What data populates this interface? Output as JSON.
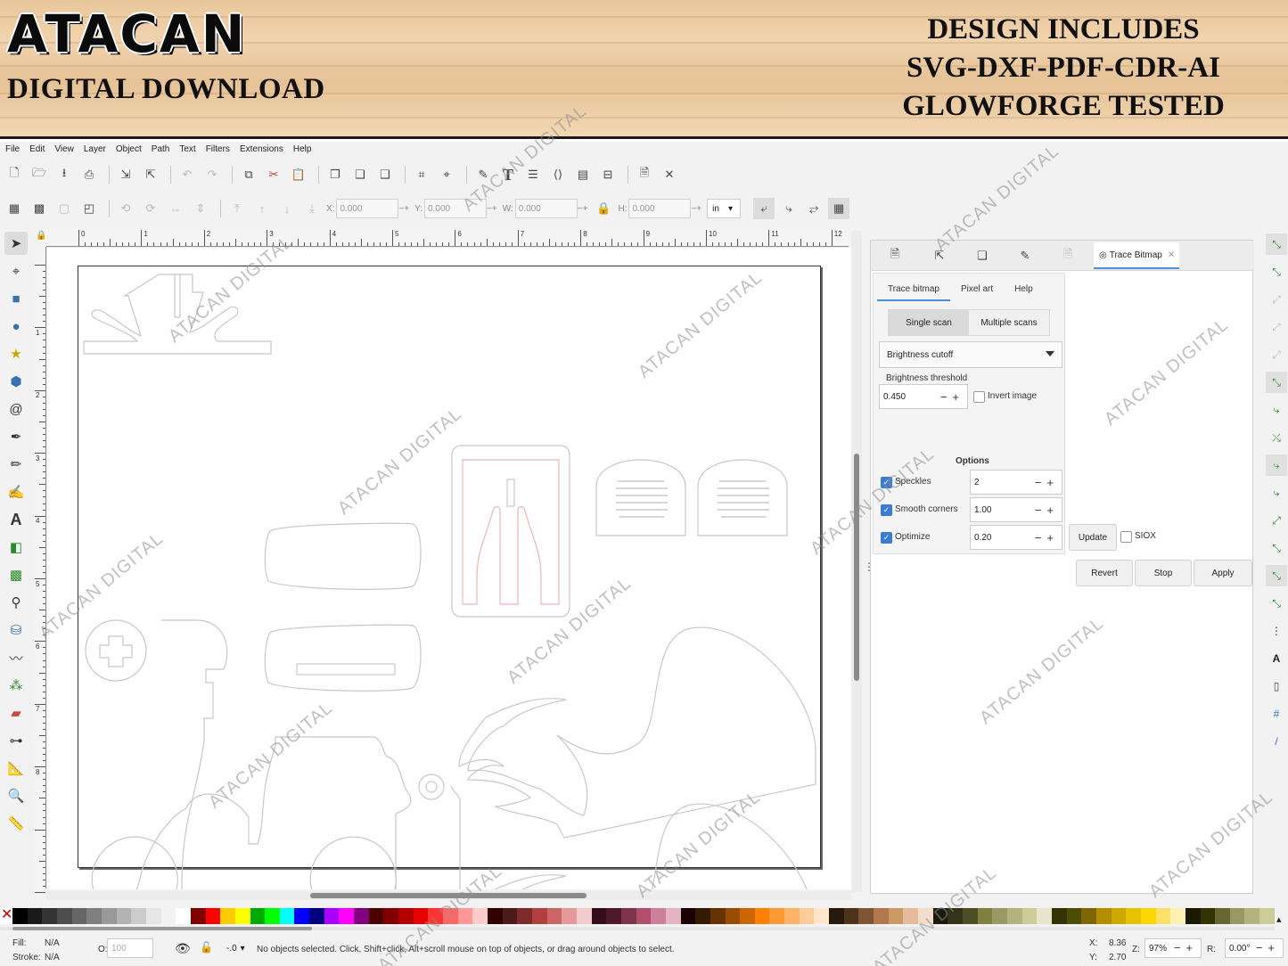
{
  "banner": {
    "logo": "ATACAN",
    "subtitle": "DIGITAL DOWNLOAD",
    "promo": [
      "DESIGN INCLUDES",
      "SVG-DXF-PDF-CDR-AI",
      "GLOWFORGE TESTED"
    ]
  },
  "menubar": [
    "File",
    "Edit",
    "View",
    "Layer",
    "Object",
    "Path",
    "Text",
    "Filters",
    "Extensions",
    "Help"
  ],
  "coords": {
    "x_label": "X:",
    "x_value": "0.000",
    "y_label": "Y:",
    "y_value": "0.000",
    "w_label": "W:",
    "w_value": "0.000",
    "h_label": "H:",
    "h_value": "0.000",
    "unit": "in"
  },
  "ruler_labels": [
    "0",
    "1",
    "2",
    "3",
    "4",
    "5",
    "6",
    "7",
    "8",
    "9",
    "10",
    "11",
    "12"
  ],
  "ruler_left_labels": [
    "1",
    "2",
    "3",
    "4",
    "5",
    "6",
    "7",
    "8"
  ],
  "dock": {
    "active_tab": "Trace Bitmap",
    "subtabs": [
      "Trace bitmap",
      "Pixel art",
      "Help"
    ],
    "scan_modes": [
      "Single scan",
      "Multiple scans"
    ],
    "mode": "Brightness cutoff",
    "threshold_label": "Brightness threshold",
    "threshold_value": "0.450",
    "invert_label": "Invert image",
    "options_heading": "Options",
    "speckles_label": "Speckles",
    "speckles_value": "2",
    "smooth_label": "Smooth corners",
    "smooth_value": "1.00",
    "optimize_label": "Optimize",
    "optimize_value": "0.20",
    "update": "Update",
    "siox": "SIOX",
    "revert": "Revert",
    "stop": "Stop",
    "apply": "Apply"
  },
  "status": {
    "fill_label": "Fill:",
    "fill_value": "N/A",
    "stroke_label": "Stroke:",
    "stroke_value": "N/A",
    "opacity_label": "O:",
    "opacity_value": "100",
    "layer_value": "-.0",
    "message": "No objects selected. Click, Shift+click, Alt+scroll mouse on top of objects, or drag around objects to select.",
    "x_label": "X:",
    "x_value": "8.36",
    "y_label": "Y:",
    "y_value": "2.70",
    "zoom_label": "Z:",
    "zoom_value": "97%",
    "rot_label": "R:",
    "rot_value": "0.00°"
  },
  "watermark": "ATACAN DIGITAL",
  "palette": [
    "#000000",
    "#1a1a1a",
    "#333333",
    "#4d4d4d",
    "#666666",
    "#808080",
    "#999999",
    "#b3b3b3",
    "#cccccc",
    "#e6e6e6",
    "#f2f2f2",
    "#ffffff",
    "#800000",
    "#ff0000",
    "#ffcc00",
    "#ffff00",
    "#00aa00",
    "#00ff00",
    "#00ffff",
    "#0000ff",
    "#000080",
    "#aa00ff",
    "#ff00ff",
    "#800080",
    "#4d0000",
    "#800000",
    "#b30000",
    "#e60000",
    "#ff3333",
    "#ff6666",
    "#ff9999",
    "#ffcccc",
    "#330000",
    "#4d1a1a",
    "#802b2b",
    "#b34040",
    "#cc6666",
    "#e69999",
    "#f2cccc",
    "#330d1a",
    "#4d1a2b",
    "#80334d",
    "#b34d6b",
    "#cc8099",
    "#e6b3c2",
    "#1a0000",
    "#331a00",
    "#663300",
    "#994d00",
    "#cc6600",
    "#ff8000",
    "#ff9933",
    "#ffb366",
    "#ffcc99",
    "#ffe6cc",
    "#261a0d",
    "#4d3319",
    "#805533",
    "#b3774d",
    "#cc9966",
    "#e6bb99",
    "#f2dccc",
    "#1a1a0d",
    "#333319",
    "#4d4d26",
    "#808040",
    "#999966",
    "#b3b380",
    "#cccc99",
    "#e6e6cc",
    "#333300",
    "#4d4d00",
    "#806600",
    "#b38f00",
    "#ccaa00",
    "#e6c200",
    "#ffd700",
    "#ffe066",
    "#fff0b3",
    "#1a1a00",
    "#333300",
    "#666633",
    "#999966",
    "#b3b380",
    "#cccc99"
  ]
}
